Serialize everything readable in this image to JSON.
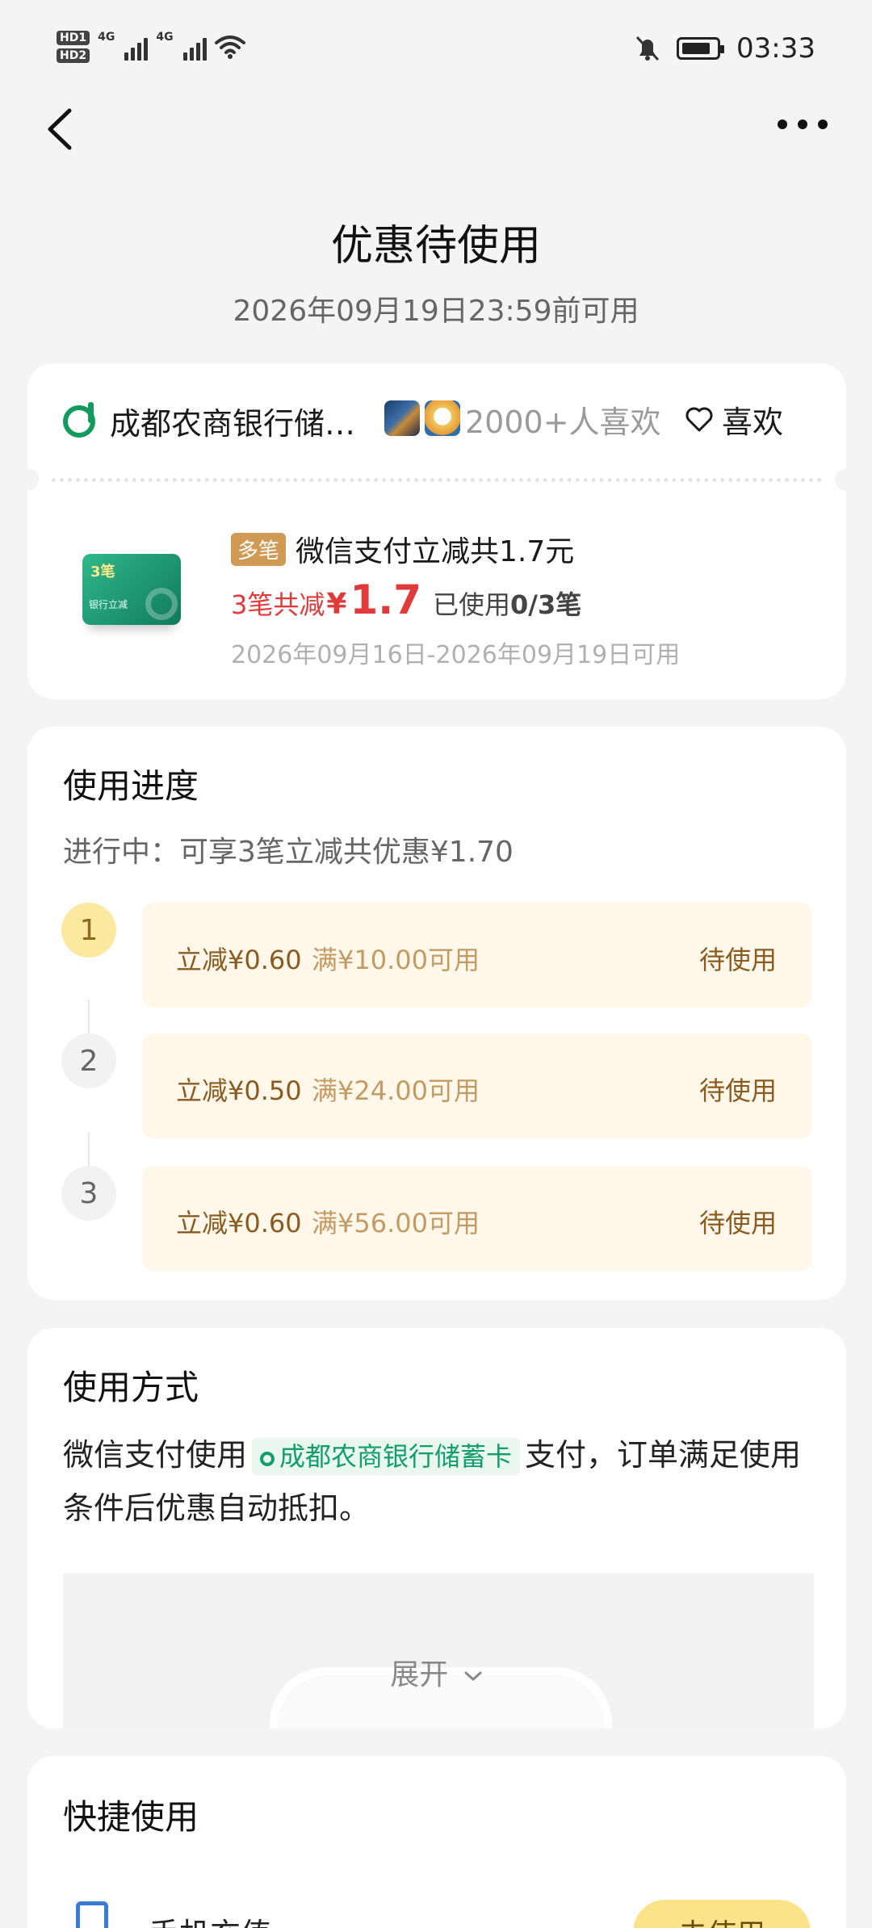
{
  "status_bar": {
    "time": "03:33",
    "left_icons": [
      "hd-icon",
      "signal-4g-icon",
      "signal-4g-icon",
      "wifi-icon"
    ],
    "right_icons": [
      "bell-muted-icon",
      "battery-icon"
    ],
    "hd_labels": [
      "HD1",
      "HD2"
    ],
    "network_labels": [
      "4G",
      "4G"
    ]
  },
  "nav": {
    "back_icon": "back-arrow-icon",
    "more_icon": "more-dots-icon"
  },
  "page": {
    "title": "优惠待使用",
    "subtitle": "2026年09月19日23:59前可用"
  },
  "merchant": {
    "name": "成都农商银行储…",
    "likes_text": "2000+人喜欢",
    "like_label": "喜欢"
  },
  "coupon": {
    "tag": "多笔",
    "title": "微信支付立减共1.7元",
    "prefix": "3笔共减",
    "currency": "¥",
    "amount": "1.7",
    "used_label": "已使用",
    "used_count": "0/3笔",
    "validity": "2026年09月16日-2026年09月19日可用",
    "image_text_top": "3笔",
    "image_text_bottom": "银行立减"
  },
  "progress": {
    "title": "使用进度",
    "desc": "进行中：可享3笔立减共优惠¥1.70",
    "steps": [
      {
        "num": "1",
        "amount": "立减¥0.60",
        "condition": "满¥10.00可用",
        "status": "待使用"
      },
      {
        "num": "2",
        "amount": "立减¥0.50",
        "condition": "满¥24.00可用",
        "status": "待使用"
      },
      {
        "num": "3",
        "amount": "立减¥0.60",
        "condition": "满¥56.00可用",
        "status": "待使用"
      }
    ]
  },
  "usage": {
    "title": "使用方式",
    "text_before": "微信支付使用",
    "card_name": "成都农商银行储蓄卡",
    "text_after": "支付，订单满足使用条件后优惠自动抵扣。",
    "expand_label": "展开"
  },
  "quick_use": {
    "title": "快捷使用",
    "item_label": "手机充值",
    "item_button": "去使用"
  },
  "colors": {
    "background": "#f4f4f4",
    "accent_red": "#e03a3a",
    "brand_green": "#139a5d",
    "step_bg": "#fff8ea",
    "active_step": "#fce9a0",
    "button_yellow": "#fce38a"
  }
}
